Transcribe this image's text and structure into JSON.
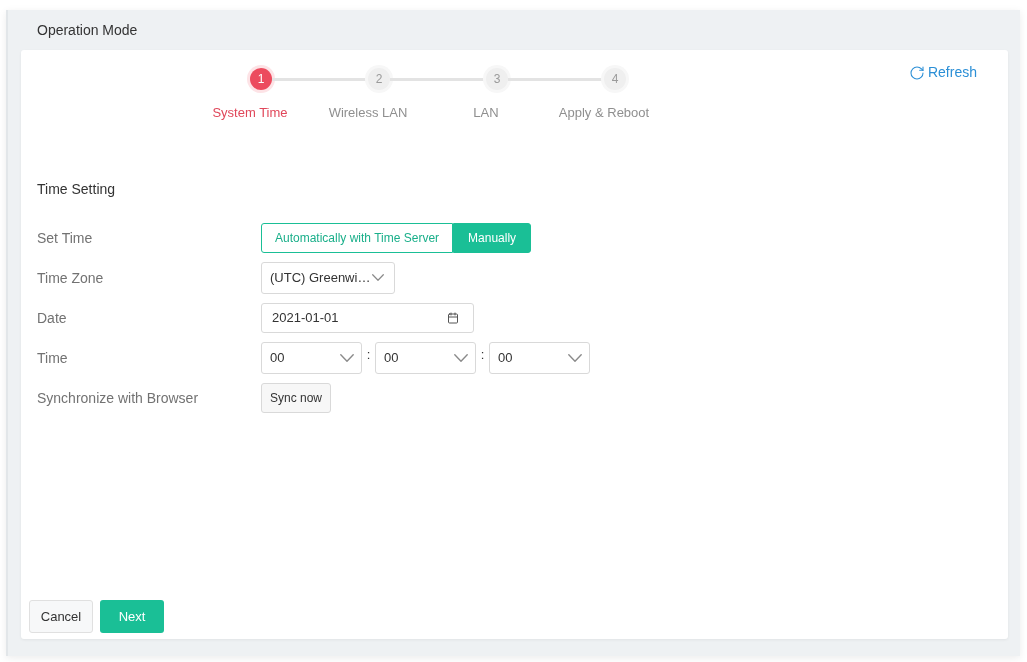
{
  "panel": {
    "title": "Operation Mode"
  },
  "steps": [
    {
      "number": "1",
      "label": "System Time",
      "selected": true
    },
    {
      "number": "2",
      "label": "Wireless LAN",
      "selected": false
    },
    {
      "number": "3",
      "label": "LAN",
      "selected": false
    },
    {
      "number": "4",
      "label": "Apply & Reboot",
      "selected": false
    }
  ],
  "refresh": {
    "label": "Refresh"
  },
  "section": {
    "title": "Time Setting"
  },
  "fields": [
    {
      "kind": "segmented",
      "label": "Set Time",
      "options": [
        {
          "label": "Automatically with Time Server",
          "selected": false
        },
        {
          "label": "Manually",
          "selected": true
        }
      ]
    },
    {
      "kind": "select",
      "label": "Time Zone",
      "value": "(UTC) Greenwi…"
    },
    {
      "kind": "date",
      "label": "Date",
      "value": "2021-01-01"
    },
    {
      "kind": "time",
      "label": "Time",
      "parts": [
        "00",
        "00",
        "00"
      ],
      "separators": [
        ":",
        ":"
      ]
    },
    {
      "kind": "action",
      "label": "Synchronize with Browser",
      "button": "Sync now"
    }
  ],
  "footer": {
    "buttons": [
      {
        "label": "Cancel",
        "kind": "secondary"
      },
      {
        "label": "Next",
        "kind": "primary"
      }
    ]
  }
}
